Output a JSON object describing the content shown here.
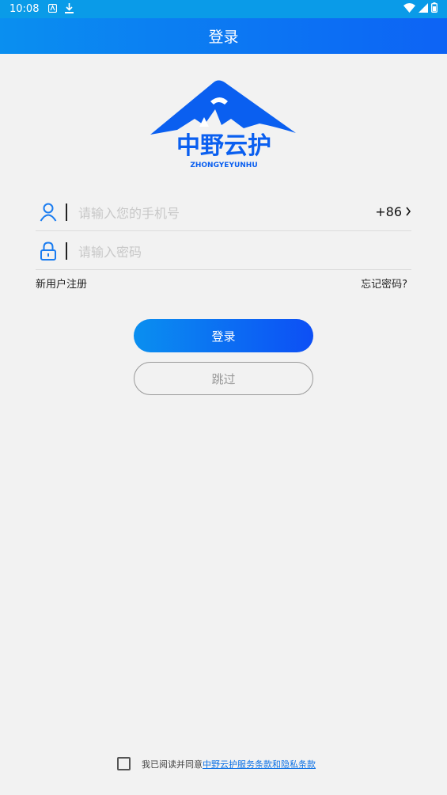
{
  "status_bar": {
    "time": "10:08",
    "icons": [
      "app-notification-icon",
      "download-icon",
      "wifi-icon",
      "signal-icon",
      "battery-icon"
    ]
  },
  "header": {
    "title": "登录"
  },
  "logo": {
    "brand_text": "中野云护",
    "brand_sub": "ZHONGYEYUNHU",
    "brand_color": "#0a5ff0"
  },
  "form": {
    "phone_placeholder": "请输入您的手机号",
    "country_code": "+86",
    "password_placeholder": "请输入密码"
  },
  "links": {
    "register": "新用户注册",
    "forgot": "忘记密码?"
  },
  "buttons": {
    "login": "登录",
    "skip": "跳过"
  },
  "agreement": {
    "prefix": "我已阅读并同意",
    "link": "中野云护服务条款和隐私条款"
  },
  "colors": {
    "accent": "#0d6ff2",
    "status_bar": "#0a9be8"
  }
}
